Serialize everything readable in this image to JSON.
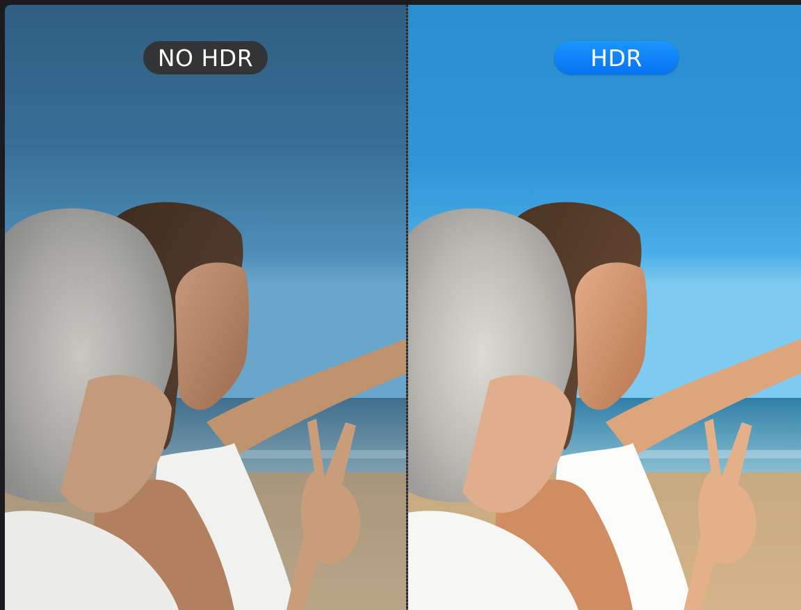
{
  "comparison": {
    "left": {
      "label": "NO HDR",
      "badge_color": "#333436",
      "image_icon": "beach-selfie-photo"
    },
    "right": {
      "label": "HDR",
      "badge_color": "#0a7ff5",
      "image_icon": "beach-selfie-photo"
    },
    "divider_style": "dashed-vertical"
  }
}
